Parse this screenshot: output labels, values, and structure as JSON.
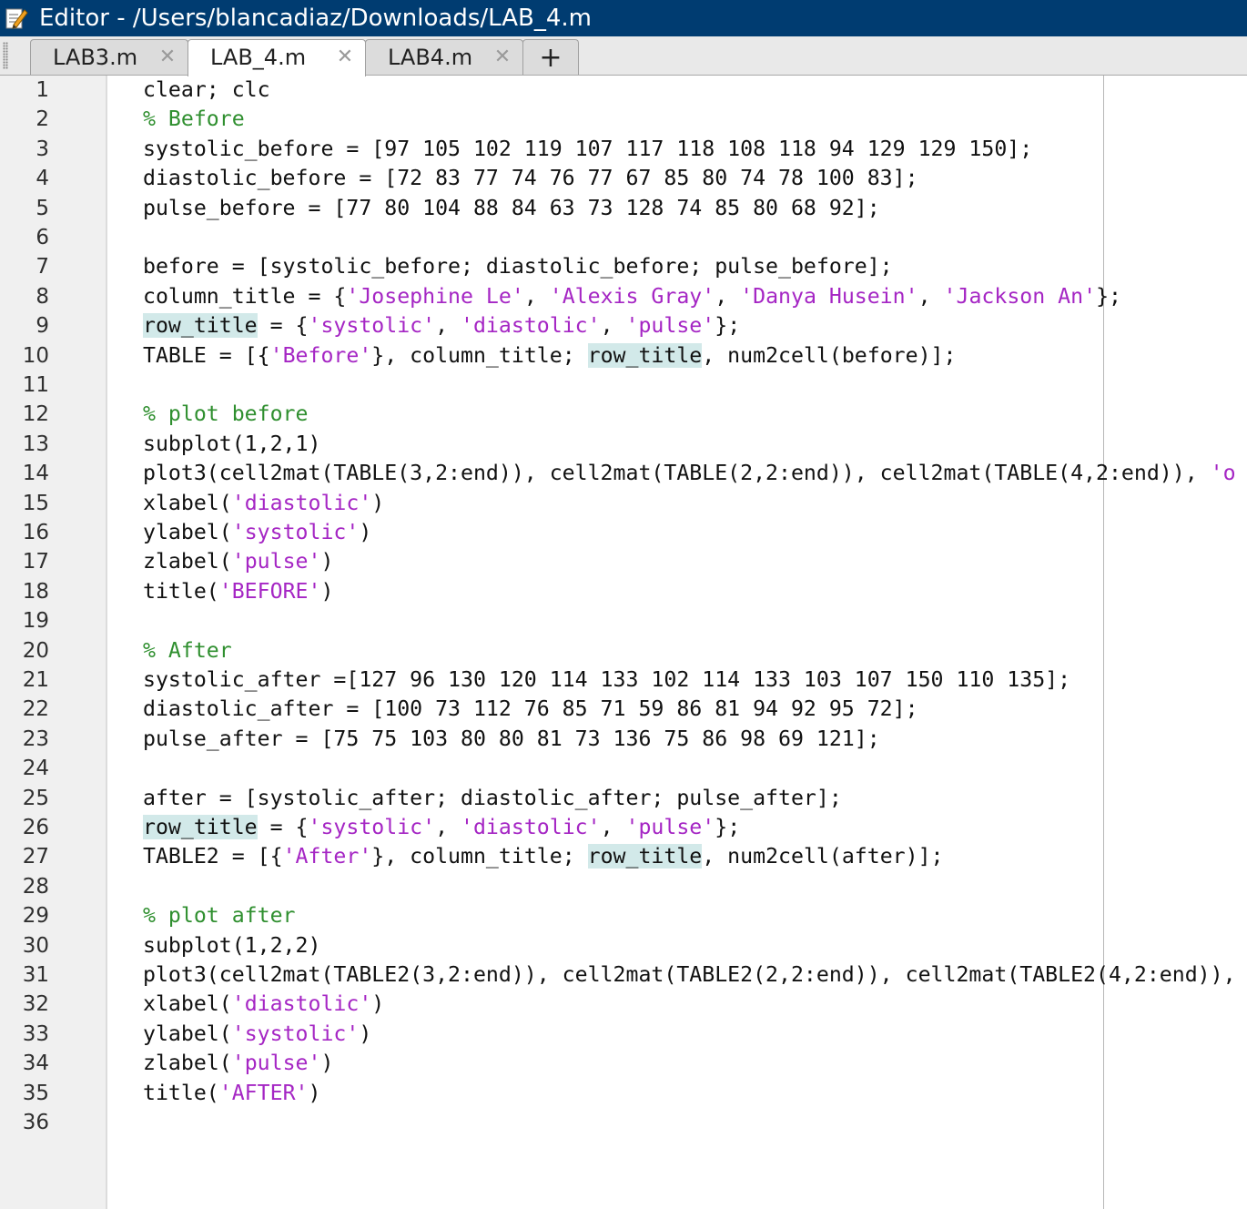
{
  "window": {
    "title": "Editor - /Users/blancadiaz/Downloads/LAB_4.m",
    "icon": "editor-pencil-icon"
  },
  "tabs": [
    {
      "label": "LAB3.m",
      "active": false
    },
    {
      "label": "LAB_4.m",
      "active": true
    },
    {
      "label": "LAB4.m",
      "active": false
    }
  ],
  "new_tab_label": "+",
  "close_glyph": "✕",
  "colors": {
    "titlebar": "#003c71",
    "string": "#a526c4",
    "comment": "#2f8f2f",
    "highlight": "#d2e9e9"
  },
  "line_numbers": [
    "1",
    "2",
    "3",
    "4",
    "5",
    "6",
    "7",
    "8",
    "9",
    "10",
    "11",
    "12",
    "13",
    "14",
    "15",
    "16",
    "17",
    "18",
    "19",
    "20",
    "21",
    "22",
    "23",
    "24",
    "25",
    "26",
    "27",
    "28",
    "29",
    "30",
    "31",
    "32",
    "33",
    "34",
    "35",
    "36"
  ],
  "code": [
    [
      {
        "t": "p",
        "s": "clear; clc"
      }
    ],
    [
      {
        "t": "c",
        "s": "% Before"
      }
    ],
    [
      {
        "t": "p",
        "s": "systolic_before = [97 105 102 119 107 117 118 108 118 94 129 129 150];"
      }
    ],
    [
      {
        "t": "p",
        "s": "diastolic_before = [72 83 77 74 76 77 67 85 80 74 78 100 83];"
      }
    ],
    [
      {
        "t": "p",
        "s": "pulse_before = [77 80 104 88 84 63 73 128 74 85 80 68 92];"
      }
    ],
    [],
    [
      {
        "t": "p",
        "s": "before = [systolic_before; diastolic_before; pulse_before];"
      }
    ],
    [
      {
        "t": "p",
        "s": "column_title = {"
      },
      {
        "t": "s",
        "s": "'Josephine Le'"
      },
      {
        "t": "p",
        "s": ", "
      },
      {
        "t": "s",
        "s": "'Alexis Gray'"
      },
      {
        "t": "p",
        "s": ", "
      },
      {
        "t": "s",
        "s": "'Danya Husein'"
      },
      {
        "t": "p",
        "s": ", "
      },
      {
        "t": "s",
        "s": "'Jackson An'"
      },
      {
        "t": "p",
        "s": "};"
      }
    ],
    [
      {
        "t": "h",
        "s": "row_title"
      },
      {
        "t": "p",
        "s": " = {"
      },
      {
        "t": "s",
        "s": "'systolic'"
      },
      {
        "t": "p",
        "s": ", "
      },
      {
        "t": "s",
        "s": "'diastolic'"
      },
      {
        "t": "p",
        "s": ", "
      },
      {
        "t": "s",
        "s": "'pulse'"
      },
      {
        "t": "p",
        "s": "};"
      }
    ],
    [
      {
        "t": "p",
        "s": "TABLE = [{"
      },
      {
        "t": "s",
        "s": "'Before'"
      },
      {
        "t": "p",
        "s": "}, column_title; "
      },
      {
        "t": "h",
        "s": "row_title"
      },
      {
        "t": "p",
        "s": ", num2cell(before)];"
      }
    ],
    [],
    [
      {
        "t": "c",
        "s": "% plot before"
      }
    ],
    [
      {
        "t": "p",
        "s": "subplot(1,2,1)"
      }
    ],
    [
      {
        "t": "p",
        "s": "plot3(cell2mat(TABLE(3,2:end)), cell2mat(TABLE(2,2:end)), cell2mat(TABLE(4,2:end)), "
      },
      {
        "t": "s",
        "s": "'o"
      }
    ],
    [
      {
        "t": "p",
        "s": "xlabel("
      },
      {
        "t": "s",
        "s": "'diastolic'"
      },
      {
        "t": "p",
        "s": ")"
      }
    ],
    [
      {
        "t": "p",
        "s": "ylabel("
      },
      {
        "t": "s",
        "s": "'systolic'"
      },
      {
        "t": "p",
        "s": ")"
      }
    ],
    [
      {
        "t": "p",
        "s": "zlabel("
      },
      {
        "t": "s",
        "s": "'pulse'"
      },
      {
        "t": "p",
        "s": ")"
      }
    ],
    [
      {
        "t": "p",
        "s": "title("
      },
      {
        "t": "s",
        "s": "'BEFORE'"
      },
      {
        "t": "p",
        "s": ")"
      }
    ],
    [],
    [
      {
        "t": "c",
        "s": "% After"
      }
    ],
    [
      {
        "t": "p",
        "s": "systolic_after =[127 96 130 120 114 133 102 114 133 103 107 150 110 135];"
      }
    ],
    [
      {
        "t": "p",
        "s": "diastolic_after = [100 73 112 76 85 71 59 86 81 94 92 95 72];"
      }
    ],
    [
      {
        "t": "p",
        "s": "pulse_after = [75 75 103 80 80 81 73 136 75 86 98 69 121];"
      }
    ],
    [],
    [
      {
        "t": "p",
        "s": "after = [systolic_after; diastolic_after; pulse_after];"
      }
    ],
    [
      {
        "t": "h",
        "s": "row_title"
      },
      {
        "t": "p",
        "s": " = {"
      },
      {
        "t": "s",
        "s": "'systolic'"
      },
      {
        "t": "p",
        "s": ", "
      },
      {
        "t": "s",
        "s": "'diastolic'"
      },
      {
        "t": "p",
        "s": ", "
      },
      {
        "t": "s",
        "s": "'pulse'"
      },
      {
        "t": "p",
        "s": "};"
      }
    ],
    [
      {
        "t": "p",
        "s": "TABLE2 = [{"
      },
      {
        "t": "s",
        "s": "'After'"
      },
      {
        "t": "p",
        "s": "}, column_title; "
      },
      {
        "t": "h",
        "s": "row_title"
      },
      {
        "t": "p",
        "s": ", num2cell(after)];"
      }
    ],
    [],
    [
      {
        "t": "c",
        "s": "% plot after"
      }
    ],
    [
      {
        "t": "p",
        "s": "subplot(1,2,2)"
      }
    ],
    [
      {
        "t": "p",
        "s": "plot3(cell2mat(TABLE2(3,2:end)), cell2mat(TABLE2(2,2:end)), cell2mat(TABLE2(4,2:end)),"
      }
    ],
    [
      {
        "t": "p",
        "s": "xlabel("
      },
      {
        "t": "s",
        "s": "'diastolic'"
      },
      {
        "t": "p",
        "s": ")"
      }
    ],
    [
      {
        "t": "p",
        "s": "ylabel("
      },
      {
        "t": "s",
        "s": "'systolic'"
      },
      {
        "t": "p",
        "s": ")"
      }
    ],
    [
      {
        "t": "p",
        "s": "zlabel("
      },
      {
        "t": "s",
        "s": "'pulse'"
      },
      {
        "t": "p",
        "s": ")"
      }
    ],
    [
      {
        "t": "p",
        "s": "title("
      },
      {
        "t": "s",
        "s": "'AFTER'"
      },
      {
        "t": "p",
        "s": ")"
      }
    ],
    []
  ]
}
